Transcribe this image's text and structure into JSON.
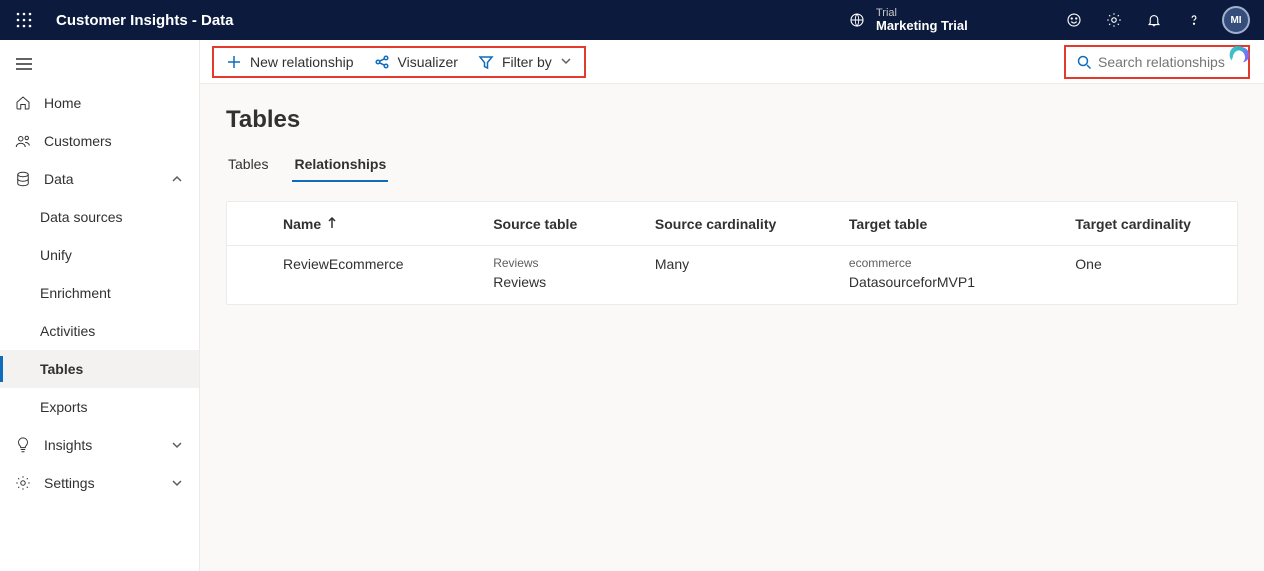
{
  "header": {
    "app_title": "Customer Insights - Data",
    "env_label": "Trial",
    "env_name": "Marketing Trial",
    "avatar_initials": "MI"
  },
  "sidebar": {
    "items": [
      {
        "id": "home",
        "label": "Home"
      },
      {
        "id": "customers",
        "label": "Customers"
      },
      {
        "id": "data",
        "label": "Data",
        "expanded": true
      },
      {
        "id": "insights",
        "label": "Insights",
        "expandable": true
      },
      {
        "id": "settings",
        "label": "Settings",
        "expandable": true
      }
    ],
    "data_children": [
      {
        "id": "data-sources",
        "label": "Data sources"
      },
      {
        "id": "unify",
        "label": "Unify"
      },
      {
        "id": "enrichment",
        "label": "Enrichment"
      },
      {
        "id": "activities",
        "label": "Activities"
      },
      {
        "id": "tables",
        "label": "Tables",
        "selected": true
      },
      {
        "id": "exports",
        "label": "Exports"
      }
    ]
  },
  "toolbar": {
    "new_label": "New relationship",
    "visualizer_label": "Visualizer",
    "filter_label": "Filter by",
    "search_placeholder": "Search relationships"
  },
  "page": {
    "title": "Tables",
    "tabs": [
      {
        "id": "tables",
        "label": "Tables"
      },
      {
        "id": "relationships",
        "label": "Relationships",
        "active": true
      }
    ]
  },
  "table": {
    "columns": {
      "name": "Name",
      "source": "Source table",
      "source_card": "Source cardinality",
      "target": "Target table",
      "target_card": "Target cardinality"
    },
    "rows": [
      {
        "name": "ReviewEcommerce",
        "source_sub": "Reviews",
        "source_main": "Reviews",
        "source_card": "Many",
        "target_sub": "ecommerce",
        "target_main": "DatasourceforMVP1",
        "target_card": "One"
      }
    ]
  }
}
